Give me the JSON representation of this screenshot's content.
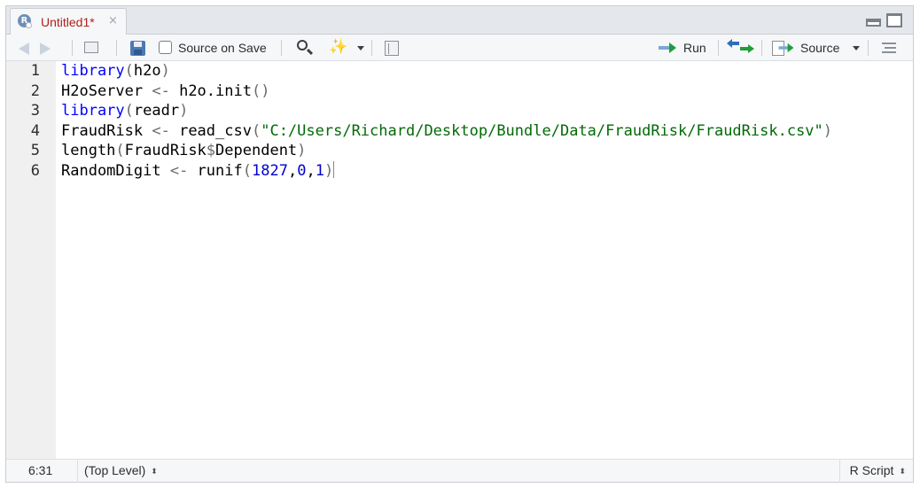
{
  "tab": {
    "title": "Untitled1*",
    "close_glyph": "×",
    "logo_letter": "R"
  },
  "toolbar": {
    "source_on_save_label": "Source on Save",
    "source_on_save_checked": false,
    "run_label": "Run",
    "source_label": "Source",
    "wand_glyph": "✨"
  },
  "editor": {
    "line_numbers": [
      "1",
      "2",
      "3",
      "4",
      "5",
      "6"
    ],
    "lines": [
      [
        {
          "t": "library",
          "c": "k"
        },
        {
          "t": "(",
          "c": "p"
        },
        {
          "t": "h2o",
          "c": ""
        },
        {
          "t": ")",
          "c": "p"
        }
      ],
      [
        {
          "t": "H2oServer ",
          "c": ""
        },
        {
          "t": "<-",
          "c": "p"
        },
        {
          "t": " h2o.init",
          "c": ""
        },
        {
          "t": "()",
          "c": "p"
        }
      ],
      [
        {
          "t": "library",
          "c": "k"
        },
        {
          "t": "(",
          "c": "p"
        },
        {
          "t": "readr",
          "c": ""
        },
        {
          "t": ")",
          "c": "p"
        }
      ],
      [
        {
          "t": "FraudRisk ",
          "c": ""
        },
        {
          "t": "<-",
          "c": "p"
        },
        {
          "t": " read_csv",
          "c": ""
        },
        {
          "t": "(",
          "c": "p"
        },
        {
          "t": "\"C:/Users/Richard/Desktop/Bundle/Data/FraudRisk/FraudRisk.csv\"",
          "c": "s"
        },
        {
          "t": ")",
          "c": "p"
        }
      ],
      [
        {
          "t": "length",
          "c": ""
        },
        {
          "t": "(",
          "c": "p"
        },
        {
          "t": "FraudRisk",
          "c": ""
        },
        {
          "t": "$",
          "c": "p"
        },
        {
          "t": "Dependent",
          "c": ""
        },
        {
          "t": ")",
          "c": "p"
        }
      ],
      [
        {
          "t": "RandomDigit ",
          "c": ""
        },
        {
          "t": "<-",
          "c": "p"
        },
        {
          "t": " runif",
          "c": ""
        },
        {
          "t": "(",
          "c": "p"
        },
        {
          "t": "1827",
          "c": "n"
        },
        {
          "t": ",",
          "c": ""
        },
        {
          "t": "0",
          "c": "n"
        },
        {
          "t": ",",
          "c": ""
        },
        {
          "t": "1",
          "c": "n"
        },
        {
          "t": ")",
          "c": "p"
        }
      ]
    ]
  },
  "status": {
    "cursor_position": "6:31",
    "scope": "(Top Level)",
    "file_type": "R Script",
    "updown_glyph": "⬍"
  },
  "colors": {
    "keyword": "#0000ff",
    "string": "#036a07",
    "number": "#0000cd",
    "tab_title": "#b0201d",
    "run_arrow": "#1f9d3a"
  },
  "icons": [
    "r-logo-icon",
    "close-icon",
    "minimize-icon",
    "maximize-icon",
    "back-arrow-icon",
    "forward-arrow-icon",
    "show-in-window-icon",
    "save-icon",
    "search-icon",
    "magic-wand-icon",
    "compile-notebook-icon",
    "run-arrow-icon",
    "rerun-icon",
    "source-icon",
    "outline-icon"
  ]
}
